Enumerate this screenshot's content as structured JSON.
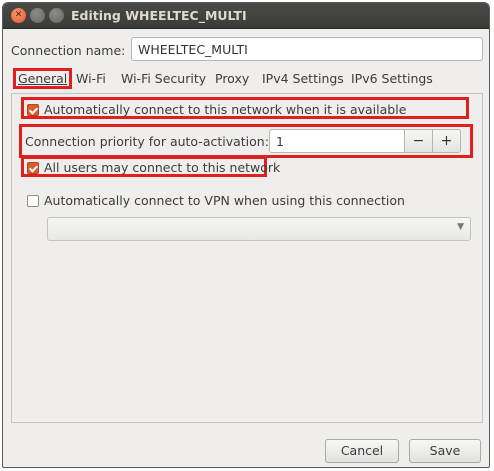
{
  "window": {
    "title": "Editing WHEELTEC_MULTI"
  },
  "connection": {
    "name_label": "Connection name:",
    "name_value": "WHEELTEC_MULTI"
  },
  "tabs": [
    {
      "label": "General",
      "active": true
    },
    {
      "label": "Wi-Fi",
      "active": false
    },
    {
      "label": "Wi-Fi Security",
      "active": false
    },
    {
      "label": "Proxy",
      "active": false
    },
    {
      "label": "IPv4 Settings",
      "active": false
    },
    {
      "label": "IPv6 Settings",
      "active": false
    }
  ],
  "general": {
    "auto_connect": {
      "label": "Automatically connect to this network when it is available",
      "checked": true
    },
    "priority": {
      "label": "Connection priority for auto-activation:",
      "value": "1",
      "minus": "−",
      "plus": "+"
    },
    "all_users": {
      "label": "All users may connect to this network",
      "checked": true
    },
    "vpn_auto": {
      "label": "Automatically connect to VPN when using this connection",
      "checked": false
    },
    "vpn_select": {
      "value": "",
      "arrow": "▼"
    }
  },
  "buttons": {
    "cancel": "Cancel",
    "save": "Save"
  },
  "colors": {
    "highlight": "#e01f1f",
    "checkbox_checked": "#dd5b2f",
    "titlebar": "#3b3b37"
  }
}
